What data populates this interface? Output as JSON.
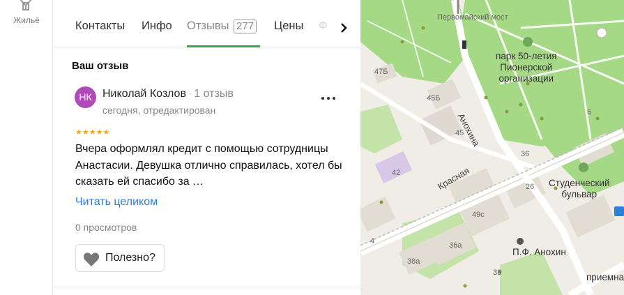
{
  "rail": {
    "housing_label": "Жильё"
  },
  "tabs": [
    {
      "label": "Контакты"
    },
    {
      "label": "Инфо"
    },
    {
      "label": "Отзывы",
      "count": "277"
    },
    {
      "label": "Цены"
    },
    {
      "label": "Ф"
    }
  ],
  "active_tab": "Отзывы",
  "review_section": {
    "title": "Ваш отзыв"
  },
  "review": {
    "avatar_initials": "НК",
    "avatar_color": "#b04ab8",
    "author": "Николай Козлов",
    "author_reviews": "1 отзыв",
    "date": "сегодня, отредактирован",
    "rating": 5,
    "stars": "★★★★★",
    "text": "Вчера оформлял кредит с помощью сотрудницы Анастасии. Девушка отлично справилась, хотел бы сказать ей спасибо за …",
    "read_more": "Читать целиком",
    "views": "0 просмотров",
    "useful_label": "Полезно?"
  },
  "map": {
    "labels": {
      "bridge": "Первомайский мост",
      "park": "парк 50-летия\nПионерской\nорганизации",
      "street_anokhina": "Анохина",
      "street_krasnaya": "Красная",
      "boulevard": "Студенческий\nбульвар",
      "poi": "П.Ф. Анохин",
      "priemnaya": "приемна",
      "b47b": "47Б",
      "b45b": "45Б",
      "b45": "45",
      "b42": "42",
      "b49s": "49с",
      "b36a": "36а",
      "b38a": "38а",
      "b26": "26",
      "b6": "6",
      "b4": "4",
      "b36": "36",
      "b38": "38"
    },
    "colors": {
      "park": "#a6d985",
      "road": "#ffffff",
      "building": "#e2ddd3",
      "water": "#8cc4e8",
      "accent": "#3aa34b"
    }
  }
}
